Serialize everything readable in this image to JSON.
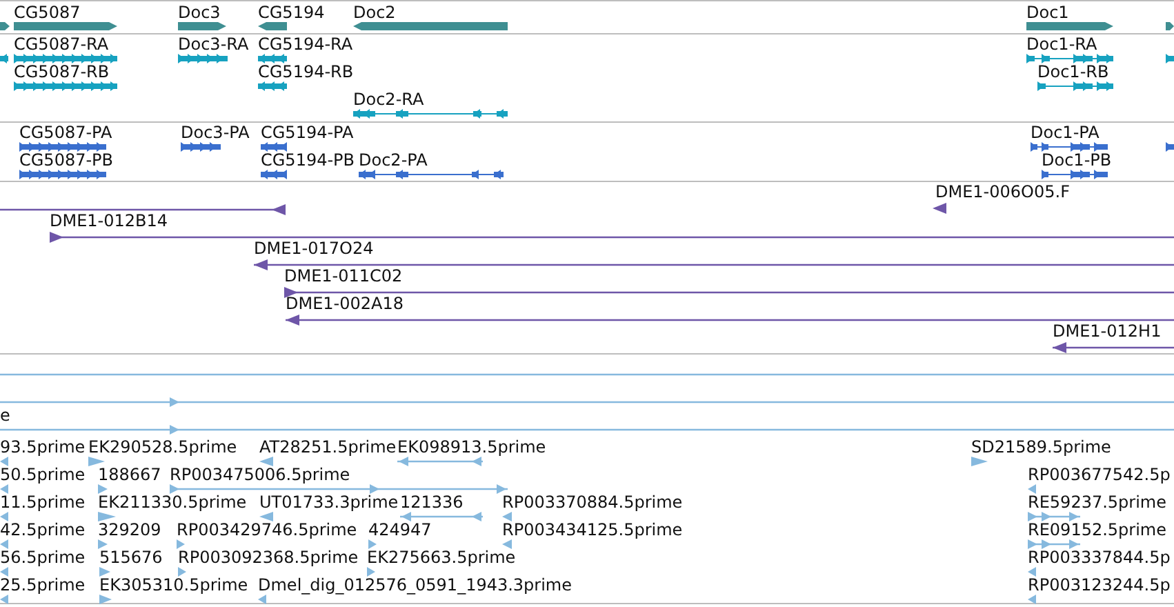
{
  "tracks": [
    {
      "kind": "gene",
      "color": "#3f8f92",
      "features": [
        {
          "reverse": false
        },
        {
          "label": "CG5087",
          "reverse": false
        },
        {
          "label": "Doc3",
          "reverse": false
        },
        {
          "label": "CG5194",
          "reverse": true
        },
        {
          "label": "Doc2",
          "reverse": true
        },
        {
          "label": "Doc1",
          "reverse": false
        },
        {
          "reverse": false
        }
      ]
    },
    {
      "kind": "transcript",
      "color": "#17a2c0",
      "features": [
        {
          "reverse": true
        },
        {
          "label": "CG5087-RA",
          "reverse": false
        },
        {
          "label": "Doc3-RA",
          "reverse": false
        },
        {
          "label": "CG5194-RA",
          "reverse": true
        },
        {
          "label": "Doc1-RA",
          "reverse": false
        },
        {
          "reverse": false
        },
        {
          "label": "CG5087-RB",
          "reverse": false
        },
        {
          "label": "CG5194-RB",
          "reverse": true
        },
        {
          "label": "Doc1-RB",
          "reverse": false
        },
        {
          "label": "Doc2-RA",
          "reverse": true
        }
      ]
    },
    {
      "kind": "protein",
      "color": "#3a6fce",
      "features": [
        {
          "label": "CG5087-PA",
          "reverse": false
        },
        {
          "label": "Doc3-PA",
          "reverse": false
        },
        {
          "label": "CG5194-PA",
          "reverse": true
        },
        {
          "label": "Doc1-PA",
          "reverse": false
        },
        {
          "reverse": false
        },
        {
          "label": "CG5087-PB",
          "reverse": false
        },
        {
          "label": "CG5194-PB",
          "reverse": true
        },
        {
          "label": "Doc2-PA",
          "reverse": true
        },
        {
          "label": "Doc1-PB",
          "reverse": false
        }
      ]
    },
    {
      "kind": "clone",
      "color": "#6e56a8",
      "features": [
        {
          "reverse": true
        },
        {
          "label": "DME1-006O05.F",
          "reverse": true
        },
        {
          "label": "DME1-012B14",
          "reverse": false
        },
        {
          "label": "DME1-017O24",
          "reverse": true
        },
        {
          "label": "DME1-011C02",
          "reverse": false
        },
        {
          "label": "DME1-002A18",
          "reverse": true
        },
        {
          "label": "DME1-012H1",
          "reverse": true
        }
      ]
    },
    {
      "kind": "est",
      "color": "#86b9de",
      "features": [
        {
          "reverse": false
        },
        {
          "label": "e",
          "reverse": false
        },
        {
          "label": "93.5prime",
          "reverse": true
        },
        {
          "label": "EK290528.5prime",
          "reverse": false
        },
        {
          "label": "AT28251.5prime",
          "reverse": true
        },
        {
          "label": "EK098913.5prime",
          "reverse": true
        },
        {
          "label": "SD21589.5prime",
          "reverse": false
        },
        {
          "label": "50.5prime",
          "reverse": true
        },
        {
          "label": "188667",
          "reverse": false
        },
        {
          "label": "RP003475006.5prime",
          "reverse": false
        },
        {
          "label": "RP003677542.5p",
          "reverse": true
        },
        {
          "label": "11.5prime",
          "reverse": true
        },
        {
          "label": "EK211330.5prime",
          "reverse": false
        },
        {
          "label": "UT01733.3prime",
          "reverse": true
        },
        {
          "label": "121336",
          "reverse": true
        },
        {
          "label": "RP003370884.5prime",
          "reverse": true
        },
        {
          "label": "RE59237.5prime",
          "reverse": false
        },
        {
          "label": "42.5prime",
          "reverse": true
        },
        {
          "label": "329209",
          "reverse": false
        },
        {
          "label": "RP003429746.5prime",
          "reverse": false
        },
        {
          "label": "424947",
          "reverse": false
        },
        {
          "label": "RP003434125.5prime",
          "reverse": true
        },
        {
          "label": "RE09152.5prime",
          "reverse": false
        },
        {
          "label": "56.5prime",
          "reverse": true
        },
        {
          "label": "515676",
          "reverse": false
        },
        {
          "label": "RP003092368.5prime",
          "reverse": false
        },
        {
          "label": "EK275663.5prime",
          "reverse": false
        },
        {
          "label": "RP003337844.5p",
          "reverse": true
        },
        {
          "label": "25.5prime",
          "reverse": true
        },
        {
          "label": "EK305310.5prime",
          "reverse": false
        },
        {
          "label": "Dmel_dig_012576_0591_1943.3prime",
          "reverse": true
        },
        {
          "label": "RP003123244.5p",
          "reverse": true
        }
      ]
    }
  ]
}
